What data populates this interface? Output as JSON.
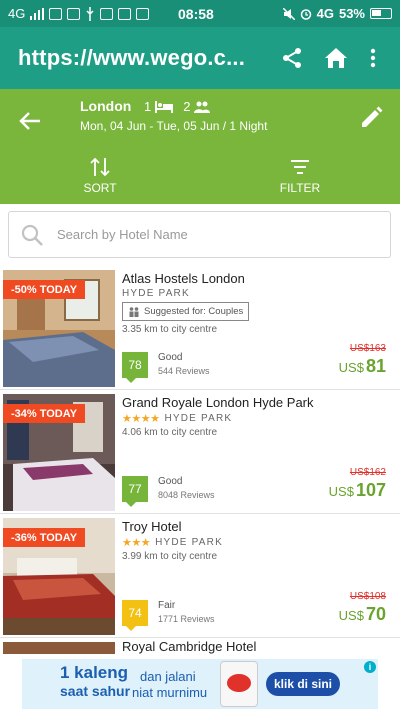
{
  "status_bar": {
    "network": "4G",
    "time": "08:58",
    "network2": "4G",
    "battery": "53%"
  },
  "browser": {
    "url": "https://www.wego.c..."
  },
  "search": {
    "city": "London",
    "rooms": "1",
    "guests": "2",
    "dates": "Mon, 04 Jun - Tue, 05 Jun / 1 Night",
    "sort_label": "SORT",
    "filter_label": "FILTER",
    "hotel_search_placeholder": "Search by Hotel Name"
  },
  "hotels": [
    {
      "deal": "-50% TODAY",
      "name": "Atlas Hostels London",
      "stars": "",
      "area": "HYDE PARK",
      "suggested": "Suggested for: Couples",
      "distance": "3.35 km to city centre",
      "score": "78",
      "score_color": "#76b53a",
      "rating_label": "Good",
      "reviews": "544 Reviews",
      "old_price": "US$163",
      "currency": "US$",
      "price": "81"
    },
    {
      "deal": "-34% TODAY",
      "name": "Grand Royale London Hyde Park",
      "stars": "★★★★",
      "area": "HYDE PARK",
      "suggested": "",
      "distance": "4.06 km to city centre",
      "score": "77",
      "score_color": "#76b53a",
      "rating_label": "Good",
      "reviews": "8048 Reviews",
      "old_price": "US$162",
      "currency": "US$",
      "price": "107"
    },
    {
      "deal": "-36% TODAY",
      "name": "Troy Hotel",
      "stars": "★★★",
      "area": "HYDE PARK",
      "suggested": "",
      "distance": "3.99 km to city centre",
      "score": "74",
      "score_color": "#f2c113",
      "rating_label": "Fair",
      "reviews": "1771 Reviews",
      "old_price": "US$108",
      "currency": "US$",
      "price": "70"
    },
    {
      "name": "Royal Cambridge Hotel"
    }
  ],
  "ad": {
    "line1": "1 kaleng",
    "line2": "saat sahur",
    "mid1": "dan jalani",
    "mid2": "niat murnimu",
    "cta": "klik di sini",
    "info": "i",
    "close": "✕"
  }
}
